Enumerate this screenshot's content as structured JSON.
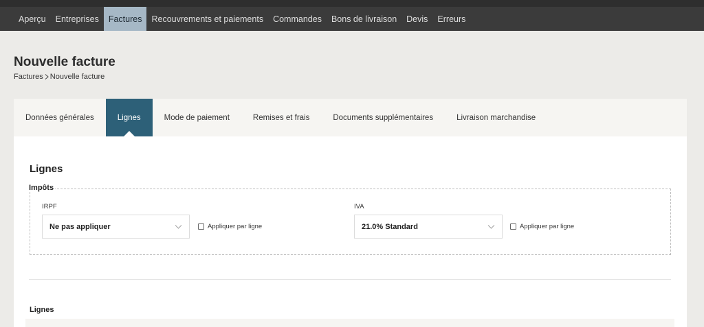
{
  "nav": {
    "items": [
      {
        "label": "Aperçu"
      },
      {
        "label": "Entreprises"
      },
      {
        "label": "Factures",
        "active": true
      },
      {
        "label": "Recouvrements et paiements"
      },
      {
        "label": "Commandes"
      },
      {
        "label": "Bons de livraison"
      },
      {
        "label": "Devis"
      },
      {
        "label": "Erreurs"
      }
    ]
  },
  "page": {
    "title": "Nouvelle facture",
    "breadcrumb": [
      "Factures",
      "Nouvelle facture"
    ]
  },
  "tabs": [
    {
      "label": "Données générales"
    },
    {
      "label": "Lignes",
      "active": true
    },
    {
      "label": "Mode de paiement"
    },
    {
      "label": "Remises et frais"
    },
    {
      "label": "Documents supplémentaires"
    },
    {
      "label": "Livraison marchandise"
    }
  ],
  "lignes": {
    "title": "Lignes",
    "impots": {
      "legend": "Impôts",
      "irpf": {
        "label": "IRPF",
        "value": "Ne pas appliquer",
        "apply_per_line": "Appliquer par ligne"
      },
      "iva": {
        "label": "IVA",
        "value": "21.0% Standard",
        "apply_per_line": "Appliquer par ligne"
      }
    },
    "lines_title": "Lignes"
  },
  "colors": {
    "nav_bg": "#3b3b3b",
    "nav_active_bg": "#a6b8c6",
    "tab_active_bg": "#2d6078",
    "page_bg": "#ecebe8"
  },
  "icons": {
    "breadcrumb_separator": "chevron-right-icon",
    "select_arrow": "chevron-down-icon"
  }
}
